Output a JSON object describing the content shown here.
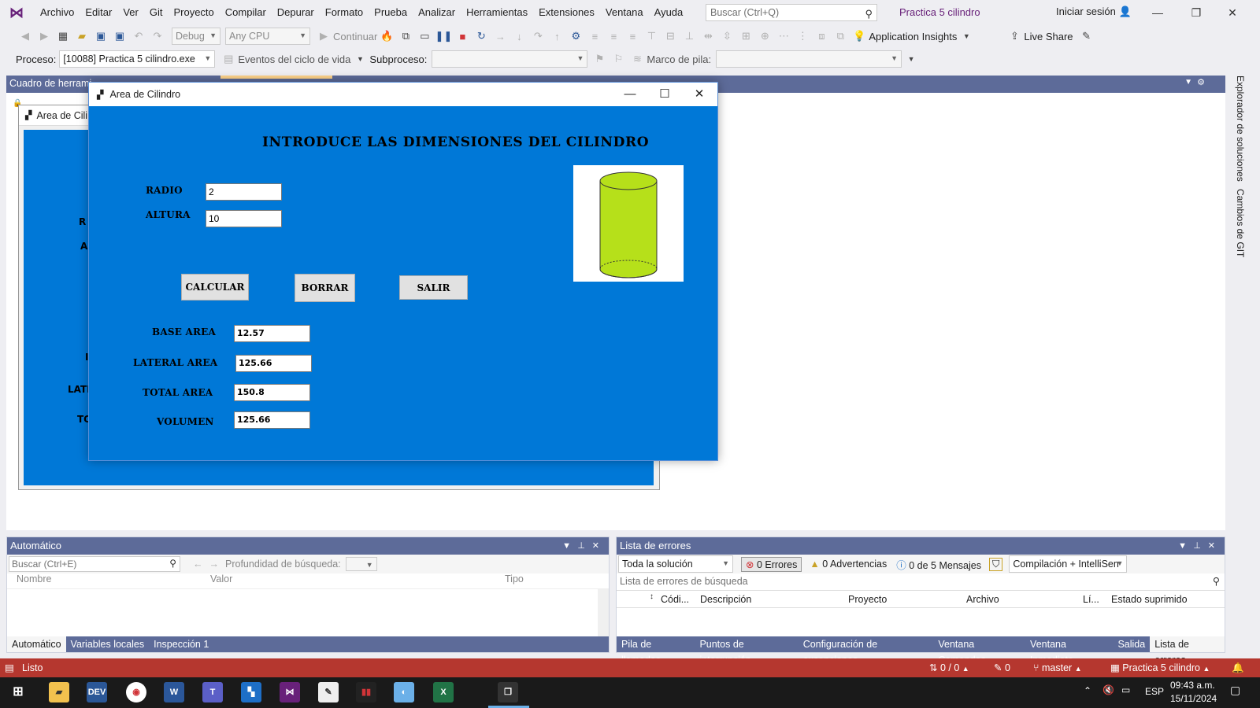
{
  "menubar": {
    "items": [
      "Archivo",
      "Editar",
      "Ver",
      "Git",
      "Proyecto",
      "Compilar",
      "Depurar",
      "Formato",
      "Prueba",
      "Analizar",
      "Herramientas",
      "Extensiones",
      "Ventana",
      "Ayuda"
    ],
    "search_placeholder": "Buscar (Ctrl+Q)",
    "solution_title": "Practica 5 cilindro",
    "signin": "Iniciar sesión"
  },
  "toolbar": {
    "config": "Debug",
    "platform": "Any CPU",
    "continue": "Continuar",
    "app_insights": "Application Insights",
    "live_share": "Live Share"
  },
  "procbar": {
    "process_label": "Proceso:",
    "process_value": "[10088] Practica 5 cilindro.exe",
    "lifecycle": "Eventos del ciclo de vida",
    "subprocess": "Subproceso:",
    "stackframe": "Marco de pila:"
  },
  "docstrip": {
    "toolbox": "Cuadro de herrami"
  },
  "right_tabs": [
    "Explorador de soluciones",
    "Cambios de GIT"
  ],
  "designer": {
    "caption": "Area de Cili",
    "partial_labels": [
      "R",
      "A",
      "I",
      "LATI",
      "TO"
    ]
  },
  "form": {
    "title": "Area de Cilindro",
    "heading": "INTRODUCE LAS DIMENSIONES DEL CILINDRO",
    "radio_label": "RADIO",
    "radio_value": "2",
    "altura_label": "ALTURA",
    "altura_value": "10",
    "btn_calcular": "CALCULAR",
    "btn_borrar": "BORRAR",
    "btn_salir": "SALIR",
    "base_label": "BASE AREA",
    "base_value": "12.57",
    "lateral_label": "LATERAL AREA",
    "lateral_value": "125.66",
    "total_label": "TOTAL AREA",
    "total_value": "150.8",
    "volumen_label": "VOLUMEN",
    "volumen_value": "125.66"
  },
  "auto_pane": {
    "title": "Automático",
    "search_placeholder": "Buscar (Ctrl+E)",
    "depth_label": "Profundidad de búsqueda:",
    "columns": [
      "Nombre",
      "Valor",
      "Tipo"
    ],
    "tabs": [
      "Automático",
      "Variables locales",
      "Inspección 1"
    ]
  },
  "errors_pane": {
    "title": "Lista de errores",
    "scope": "Toda la solución",
    "errors": "0 Errores",
    "warnings": "0 Advertencias",
    "messages": "0 de 5 Mensajes",
    "build": "Compilación + IntelliSen",
    "search_placeholder": "Lista de errores de búsqueda",
    "columns": [
      "Códi...",
      "Descripción",
      "Proyecto",
      "Archivo",
      "Lí...",
      "Estado suprimido"
    ],
    "tabs": [
      "Pila de llamadas",
      "Puntos de interrupción",
      "Configuración de excepciones",
      "Ventana Comandos",
      "Ventana Inmediato",
      "Salida",
      "Lista de errores"
    ]
  },
  "statusbar": {
    "status": "Listo",
    "changes": "0 / 0",
    "edits": "0",
    "branch": "master",
    "project": "Practica 5 cilindro"
  },
  "taskbar": {
    "lang": "ESP",
    "time": "09:43 a.m.",
    "date": "15/11/2024"
  },
  "colors": {
    "form_bg": "#0078d7",
    "cylinder_fill": "#b6e01a",
    "statusbar": "#b5372f",
    "vs_purple": "#68217a",
    "panel_header": "#5d6b99"
  }
}
